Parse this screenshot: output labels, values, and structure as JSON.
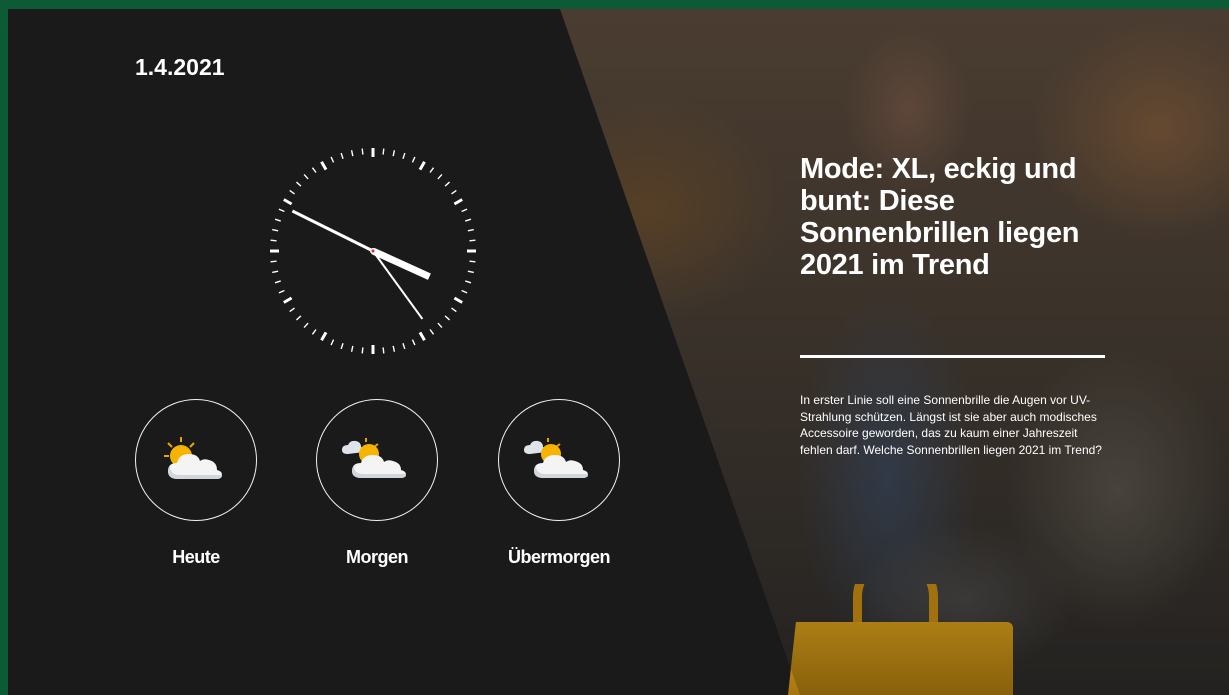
{
  "date": "1.4.2021",
  "clock": {
    "hour": 3,
    "minute": 49,
    "second": 24
  },
  "forecast": [
    {
      "label": "Heute",
      "icon": "partly-cloudy-icon"
    },
    {
      "label": "Morgen",
      "icon": "partly-cloudy-icon"
    },
    {
      "label": "Übermorgen",
      "icon": "partly-cloudy-icon"
    }
  ],
  "article": {
    "headline": "Mode: XL, eckig und bunt: Diese Sonnenbrillen liegen 2021 im Trend",
    "teaser": "In erster Linie soll eine Sonnenbrille die Augen vor UV-Strahlung schützen. Längst ist sie aber auch modisches Accessoire geworden, das zu kaum einer Jahreszeit fehlen darf. Welche Sonnenbrillen liegen 2021 im Trend?"
  },
  "colors": {
    "frame": "#0d5a36",
    "panel": "#1b1a1a",
    "second_hand_tip": "#d62828"
  }
}
